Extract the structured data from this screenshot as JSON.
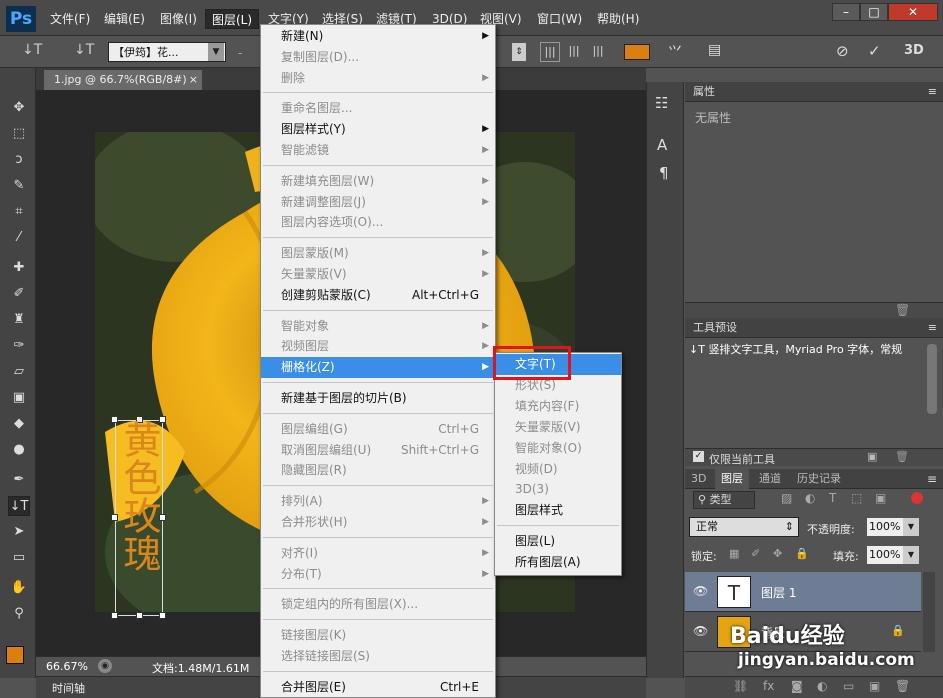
{
  "app": {
    "logo": "Ps",
    "menus": [
      "文件(F)",
      "编辑(E)",
      "图像(I)",
      "图层(L)",
      "文字(Y)",
      "选择(S)",
      "滤镜(T)",
      "3D(D)",
      "视图(V)",
      "窗口(W)",
      "帮助(H)"
    ],
    "window_buttons": [
      "–",
      "□",
      "✕"
    ]
  },
  "options_bar": {
    "tool_glyph": "↓T",
    "font_family": "【伊筠】花...",
    "mode_3d": "3D"
  },
  "document": {
    "tab_title": "1.jpg @ 66.7%(RGB/8#)",
    "tab_close": "×",
    "text_layer_content": "黄色玫瑰",
    "zoom": "66.67%",
    "doc_info": "文档:1.48M/1.61M",
    "timeline_label": "时间轴"
  },
  "layer_menu": {
    "items": [
      {
        "label": "新建(N)",
        "enabled": true,
        "submenu": true
      },
      {
        "label": "复制图层(D)...",
        "enabled": false
      },
      {
        "label": "删除",
        "enabled": false,
        "submenu": true
      },
      {
        "sep": true
      },
      {
        "label": "重命名图层...",
        "enabled": false
      },
      {
        "label": "图层样式(Y)",
        "enabled": true,
        "submenu": true
      },
      {
        "label": "智能滤镜",
        "enabled": false,
        "submenu": true
      },
      {
        "sep": true
      },
      {
        "label": "新建填充图层(W)",
        "enabled": false,
        "submenu": true
      },
      {
        "label": "新建调整图层(J)",
        "enabled": false,
        "submenu": true
      },
      {
        "label": "图层内容选项(O)...",
        "enabled": false
      },
      {
        "sep": true
      },
      {
        "label": "图层蒙版(M)",
        "enabled": false,
        "submenu": true
      },
      {
        "label": "矢量蒙版(V)",
        "enabled": false,
        "submenu": true
      },
      {
        "label": "创建剪贴蒙版(C)",
        "enabled": true,
        "shortcut": "Alt+Ctrl+G"
      },
      {
        "sep": true
      },
      {
        "label": "智能对象",
        "enabled": false,
        "submenu": true
      },
      {
        "label": "视频图层",
        "enabled": false,
        "submenu": true
      },
      {
        "label": "栅格化(Z)",
        "enabled": true,
        "submenu": true,
        "highlighted": true
      },
      {
        "sep": true
      },
      {
        "label": "新建基于图层的切片(B)",
        "enabled": true
      },
      {
        "sep": true
      },
      {
        "label": "图层编组(G)",
        "enabled": false,
        "shortcut": "Ctrl+G"
      },
      {
        "label": "取消图层编组(U)",
        "enabled": false,
        "shortcut": "Shift+Ctrl+G"
      },
      {
        "label": "隐藏图层(R)",
        "enabled": false
      },
      {
        "sep": true
      },
      {
        "label": "排列(A)",
        "enabled": false,
        "submenu": true
      },
      {
        "label": "合并形状(H)",
        "enabled": false,
        "submenu": true
      },
      {
        "sep": true
      },
      {
        "label": "对齐(I)",
        "enabled": false,
        "submenu": true
      },
      {
        "label": "分布(T)",
        "enabled": false,
        "submenu": true
      },
      {
        "sep": true
      },
      {
        "label": "锁定组内的所有图层(X)...",
        "enabled": false
      },
      {
        "sep": true
      },
      {
        "label": "链接图层(K)",
        "enabled": false
      },
      {
        "label": "选择链接图层(S)",
        "enabled": false
      },
      {
        "sep": true
      },
      {
        "label": "合并图层(E)",
        "enabled": true,
        "shortcut": "Ctrl+E"
      }
    ]
  },
  "rasterize_submenu": {
    "items": [
      {
        "label": "文字(T)",
        "enabled": true,
        "highlighted": true
      },
      {
        "label": "形状(S)",
        "enabled": false
      },
      {
        "label": "填充内容(F)",
        "enabled": false
      },
      {
        "label": "矢量蒙版(V)",
        "enabled": false
      },
      {
        "label": "智能对象(O)",
        "enabled": false
      },
      {
        "label": "视频(D)",
        "enabled": false
      },
      {
        "label": "3D(3)",
        "enabled": false
      },
      {
        "label": "图层样式",
        "enabled": true
      },
      {
        "sep": true
      },
      {
        "label": "图层(L)",
        "enabled": true
      },
      {
        "label": "所有图层(A)",
        "enabled": true
      }
    ]
  },
  "properties_panel": {
    "title": "属性",
    "empty_text": "无属性"
  },
  "tool_presets_panel": {
    "title": "工具预设",
    "preset_text": "竖排文字工具，Myriad Pro 字体，常规",
    "current_tool_only": "仅限当前工具"
  },
  "layers_panel": {
    "tabs": [
      "3D",
      "图层",
      "通道",
      "历史记录"
    ],
    "active_tab": 1,
    "filter_kind": "类型",
    "blend_mode": "正常",
    "opacity_label": "不透明度:",
    "opacity_value": "100%",
    "lock_label": "锁定:",
    "fill_label": "填充:",
    "fill_value": "100%",
    "layers": [
      {
        "name": "图层 1",
        "type": "text",
        "selected": true
      },
      {
        "name": "背景",
        "type": "image",
        "selected": false
      }
    ]
  },
  "watermark": {
    "brand": "Baidu经验",
    "url": "jingyan.baidu.com"
  },
  "colors": {
    "accent": "#3a8ee6",
    "highlight_box": "#e0141e",
    "text_color": "#d9861a",
    "foreground_swatch": "#d98010"
  }
}
